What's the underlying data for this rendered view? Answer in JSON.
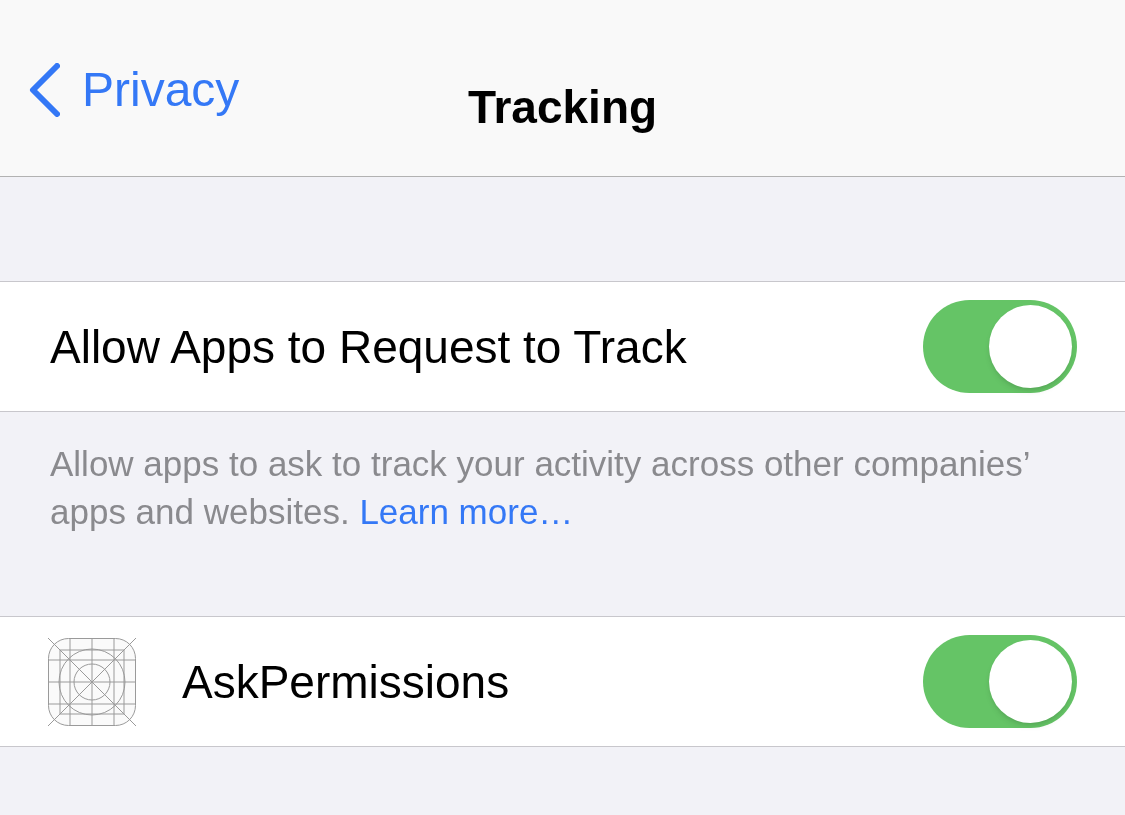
{
  "nav": {
    "back_label": "Privacy",
    "title": "Tracking"
  },
  "sections": [
    {
      "rows": [
        {
          "kind": "toggle",
          "label": "Allow Apps to Request to Track",
          "on": true
        }
      ],
      "footer": {
        "text": "Allow apps to ask to track your activity across other companies’ apps and websites.",
        "link": "Learn more…"
      }
    },
    {
      "rows": [
        {
          "kind": "app",
          "label": "AskPermissions",
          "on": true
        }
      ]
    }
  ]
}
